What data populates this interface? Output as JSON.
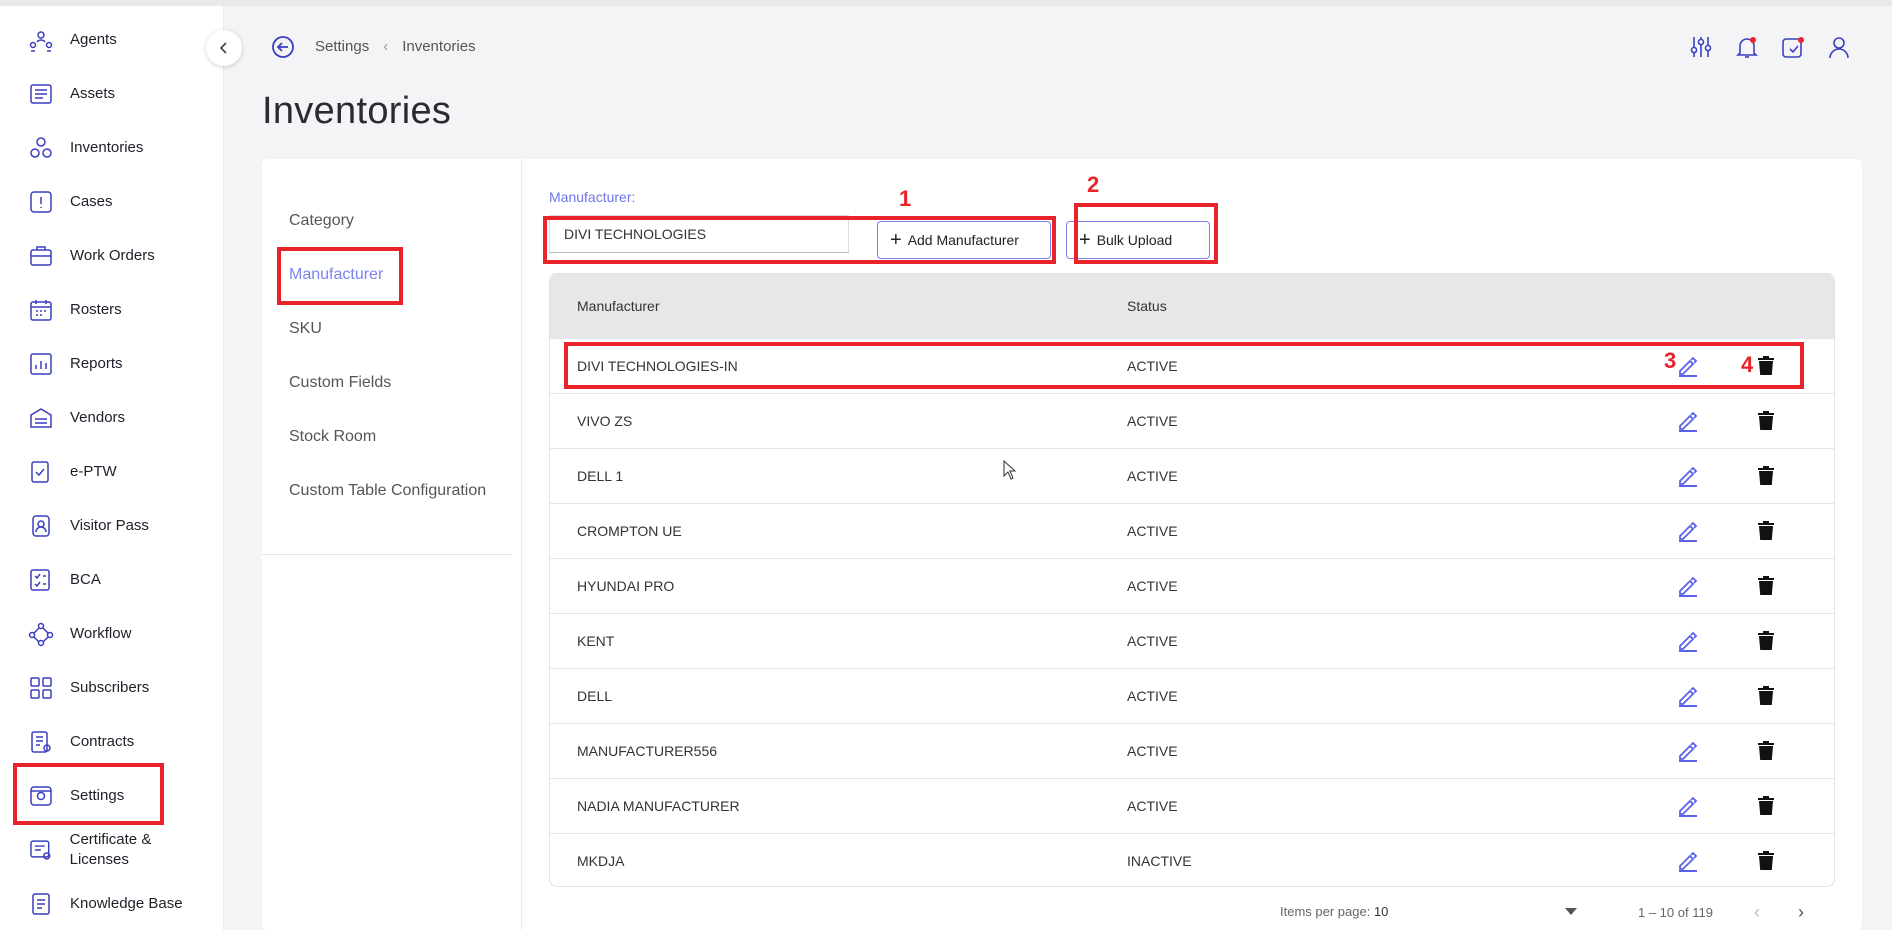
{
  "sidebar": {
    "items": [
      {
        "label": "Agents",
        "icon": "agents-icon"
      },
      {
        "label": "Assets",
        "icon": "assets-icon"
      },
      {
        "label": "Inventories",
        "icon": "inventories-icon"
      },
      {
        "label": "Cases",
        "icon": "cases-icon"
      },
      {
        "label": "Work Orders",
        "icon": "work-orders-icon"
      },
      {
        "label": "Rosters",
        "icon": "rosters-icon"
      },
      {
        "label": "Reports",
        "icon": "reports-icon"
      },
      {
        "label": "Vendors",
        "icon": "vendors-icon"
      },
      {
        "label": "e-PTW",
        "icon": "eptw-icon"
      },
      {
        "label": "Visitor Pass",
        "icon": "visitor-pass-icon"
      },
      {
        "label": "BCA",
        "icon": "bca-icon"
      },
      {
        "label": "Workflow",
        "icon": "workflow-icon"
      },
      {
        "label": "Subscribers",
        "icon": "subscribers-icon"
      },
      {
        "label": "Contracts",
        "icon": "contracts-icon"
      },
      {
        "label": "Settings",
        "icon": "settings-icon"
      },
      {
        "label": "Certificate & Licenses",
        "icon": "certificate-icon"
      },
      {
        "label": "Knowledge Base",
        "icon": "knowledge-base-icon"
      }
    ]
  },
  "header": {
    "breadcrumb": [
      "Settings",
      "Inventories"
    ],
    "title": "Inventories"
  },
  "subnav": {
    "items": [
      "Category",
      "Manufacturer",
      "SKU",
      "Custom Fields",
      "Stock Room",
      "Custom Table Configuration"
    ],
    "active": "Manufacturer"
  },
  "manufacturer_form": {
    "label": "Manufacturer:",
    "value": "DIVI TECHNOLOGIES",
    "add_label": "Add Manufacturer",
    "bulk_label": "Bulk Upload"
  },
  "table": {
    "headers": [
      "Manufacturer",
      "Status"
    ],
    "rows": [
      {
        "name": "DIVI TECHNOLOGIES-IN",
        "status": "ACTIVE"
      },
      {
        "name": "VIVO ZS",
        "status": "ACTIVE"
      },
      {
        "name": "DELL 1",
        "status": "ACTIVE"
      },
      {
        "name": "CROMPTON UE",
        "status": "ACTIVE"
      },
      {
        "name": "HYUNDAI PRO",
        "status": "ACTIVE"
      },
      {
        "name": "KENT",
        "status": "ACTIVE"
      },
      {
        "name": "DELL",
        "status": "ACTIVE"
      },
      {
        "name": "MANUFACTURER556",
        "status": "ACTIVE"
      },
      {
        "name": "NADIA MANUFACTURER",
        "status": "ACTIVE"
      },
      {
        "name": "MKDJA",
        "status": "INACTIVE"
      }
    ]
  },
  "pagination": {
    "items_per_page_label": "Items per page:",
    "items_per_page": "10",
    "range": "1 – 10 of 119"
  },
  "annotations": [
    "1",
    "2",
    "3",
    "4"
  ],
  "colors": {
    "accent": "#7c83ee",
    "annotation": "#e8232b",
    "icon": "#3a3fbf"
  }
}
